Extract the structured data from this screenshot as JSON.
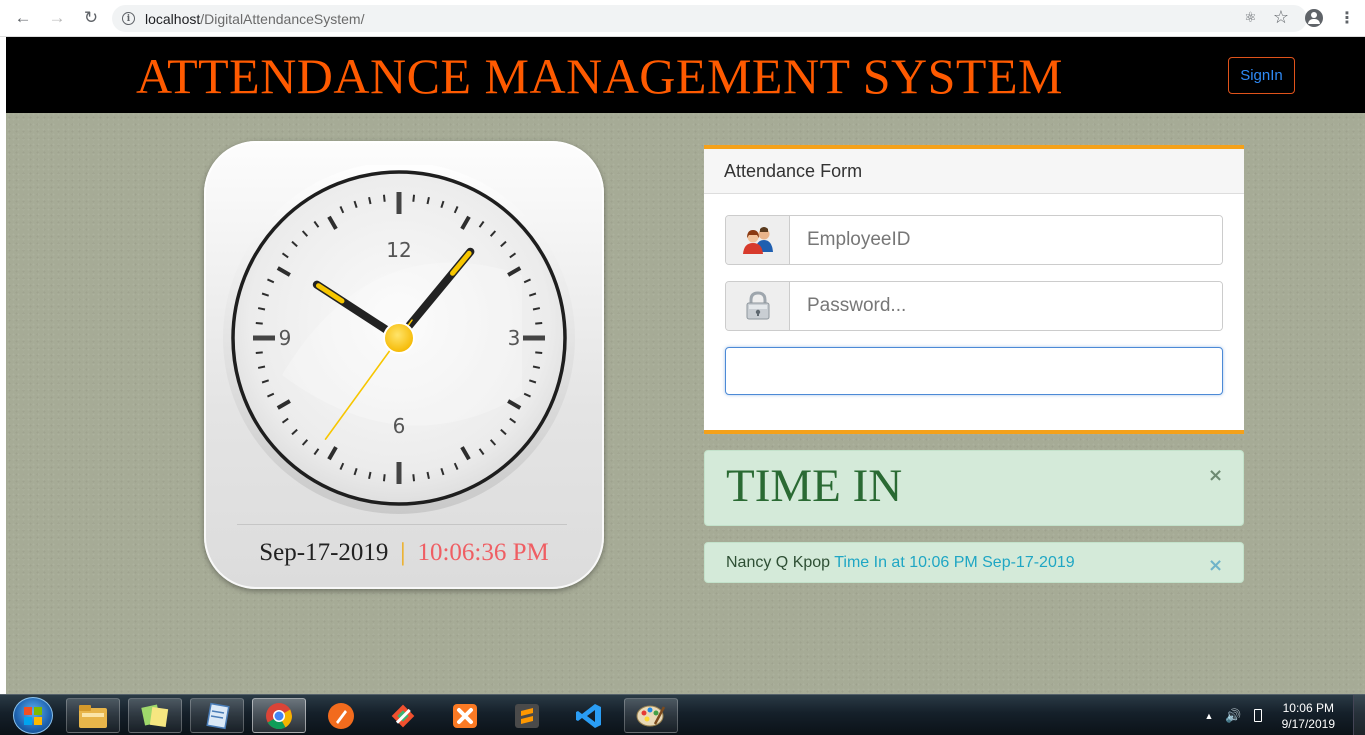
{
  "browser": {
    "url_host": "localhost",
    "url_path": "/DigitalAttendanceSystem/"
  },
  "header": {
    "title": "ATTENDANCE MANAGEMENT SYSTEM",
    "signin_label": "SignIn"
  },
  "clock": {
    "numerals": [
      "12",
      "3",
      "6",
      "9"
    ],
    "date": "Sep-17-2019",
    "separator": "|",
    "time": "10:06:36 PM",
    "hands": {
      "hour": 10,
      "minute": 6,
      "second": 36
    }
  },
  "attendance_form": {
    "heading": "Attendance Form",
    "employee_id_placeholder": "EmployeeID",
    "password_placeholder": "Password..."
  },
  "alerts": {
    "timein_text": "TIME IN",
    "close_symbol": "×",
    "info_name": "Nancy Q Kpop",
    "info_message": "Time In at 10:06 PM Sep-17-2019"
  },
  "taskbar": {
    "clock_time": "10:06 PM",
    "clock_date": "9/17/2019"
  },
  "colors": {
    "title": "#ff5a00",
    "signin_text": "#2f8af5",
    "form_border": "#f4a11a",
    "timein_text": "#2a6a33",
    "info_message": "#1fa6c4",
    "clock_time": "#ef5e63",
    "hand_accent": "#f7c600"
  },
  "icons": {
    "back": "arrow-left-icon",
    "forward": "arrow-right-icon",
    "reload": "reload-icon",
    "info": "info-icon",
    "key": "key-icon",
    "bookmark": "star-icon",
    "profile": "profile-icon",
    "menu": "kebab-menu-icon",
    "employee_addon": "users-icon",
    "password_addon": "lock-icon"
  }
}
